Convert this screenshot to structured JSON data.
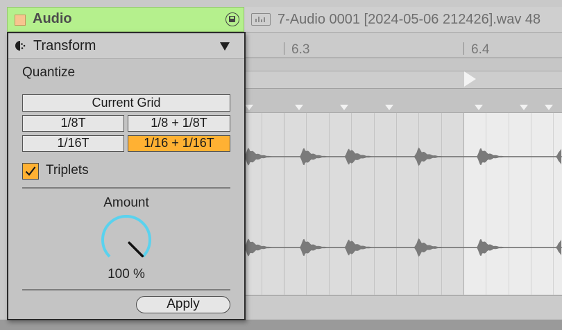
{
  "track": {
    "name": "Audio"
  },
  "clip": {
    "title": "7-Audio 0001 [2024-05-06 212426].wav  48"
  },
  "ruler": {
    "labels": [
      "6.3",
      "6.4"
    ]
  },
  "transform": {
    "title": "Transform",
    "quantize": {
      "label": "Quantize",
      "current_grid": "Current Grid",
      "grid_options": [
        "1/8T",
        "1/8 + 1/8T",
        "1/16T",
        "1/16 + 1/16T"
      ],
      "selected": "1/16 + 1/16T"
    },
    "triplets": {
      "label": "Triplets",
      "checked": true
    },
    "amount": {
      "label": "Amount",
      "value_text": "100 %",
      "value": 1.0
    },
    "apply_label": "Apply"
  },
  "colors": {
    "track_title_bg": "#b5f08d",
    "active_option": "#ffb133",
    "knob_arc": "#5ad2ee",
    "panel_bg": "#c4c4c4"
  }
}
